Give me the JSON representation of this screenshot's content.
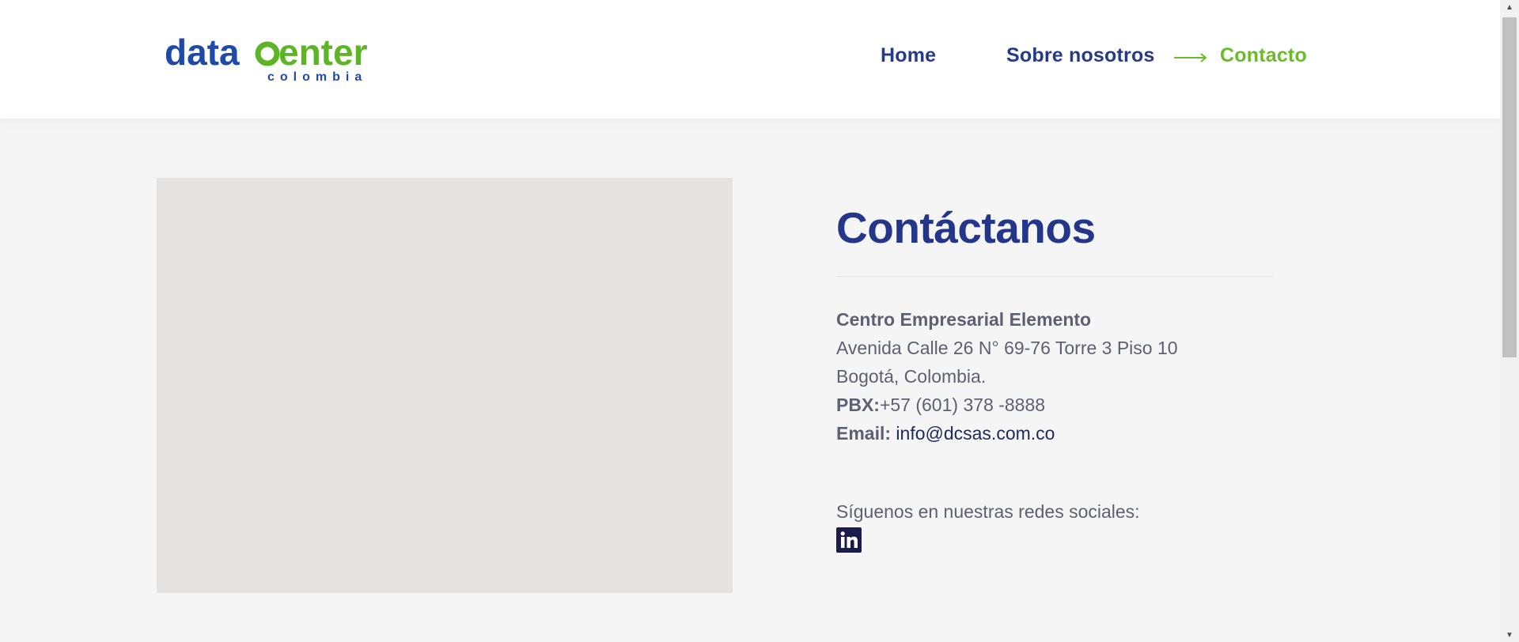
{
  "brand": {
    "logo_text_data": "data",
    "logo_text_center": "center",
    "logo_subtext": "colombia",
    "colors": {
      "blue": "#1f4aa8",
      "green": "#5db526",
      "navy": "#24368a"
    }
  },
  "nav": {
    "items": [
      {
        "label": "Home"
      },
      {
        "label": "Sobre nosotros"
      },
      {
        "label": "Contacto",
        "active": true
      }
    ]
  },
  "contact": {
    "title": "Contáctanos",
    "company": "Centro Empresarial Elemento",
    "address": "Avenida Calle 26 N° 69-76 Torre 3 Piso 10",
    "city": "Bogotá, Colombia.",
    "pbx_label": "PBX:",
    "pbx_value": "+57 (601) 378 -8888",
    "email_label": "Email:",
    "email_value": "info@dcsas.com.co",
    "social_label": "Síguenos en nuestras redes sociales:",
    "social_icon": "linkedin-icon"
  }
}
